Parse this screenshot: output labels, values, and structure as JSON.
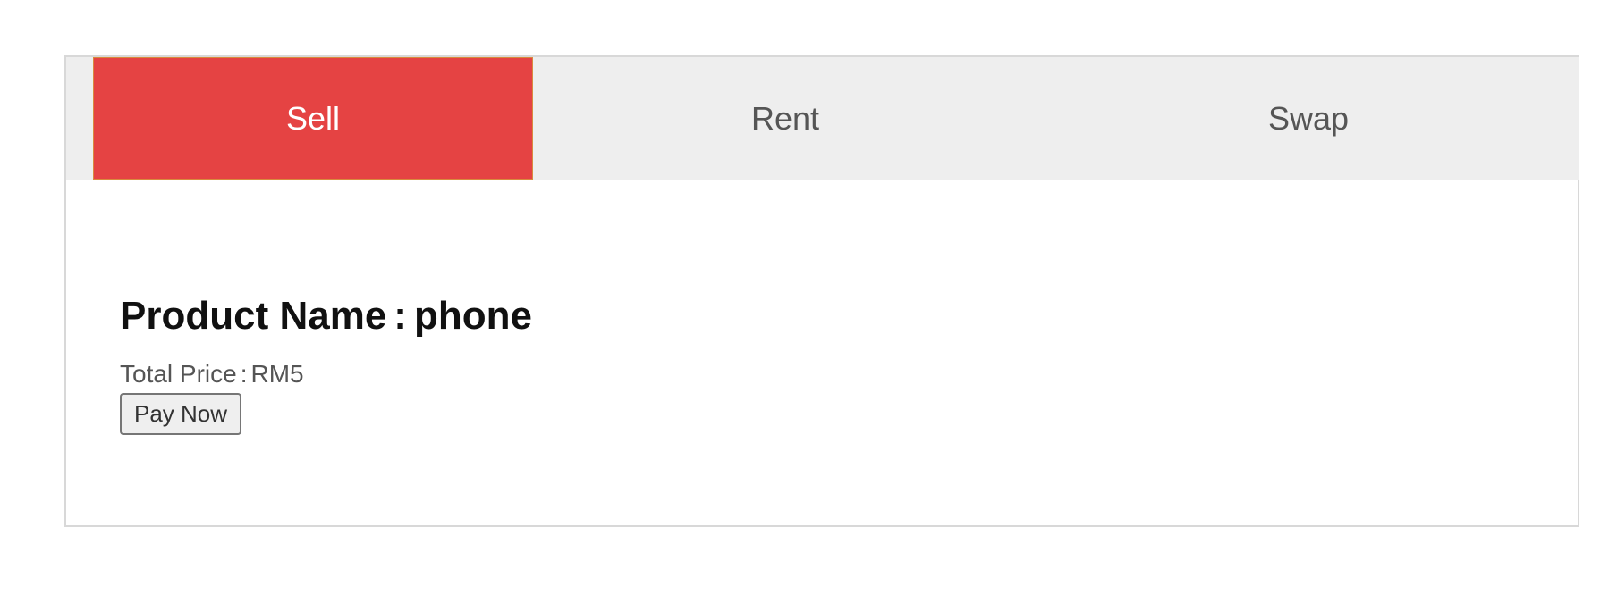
{
  "tabs": [
    {
      "label": "Sell",
      "active": true
    },
    {
      "label": "Rent",
      "active": false
    },
    {
      "label": "Swap",
      "active": false
    }
  ],
  "product": {
    "name_label": "Product Name",
    "separator": ":",
    "name_value": "phone",
    "price_label": "Total Price",
    "price_value": "RM5",
    "pay_button_label": "Pay Now"
  },
  "colors": {
    "active_tab": "#e54343",
    "tab_bar": "#eeeeee",
    "panel_border": "#d8d8d8"
  }
}
